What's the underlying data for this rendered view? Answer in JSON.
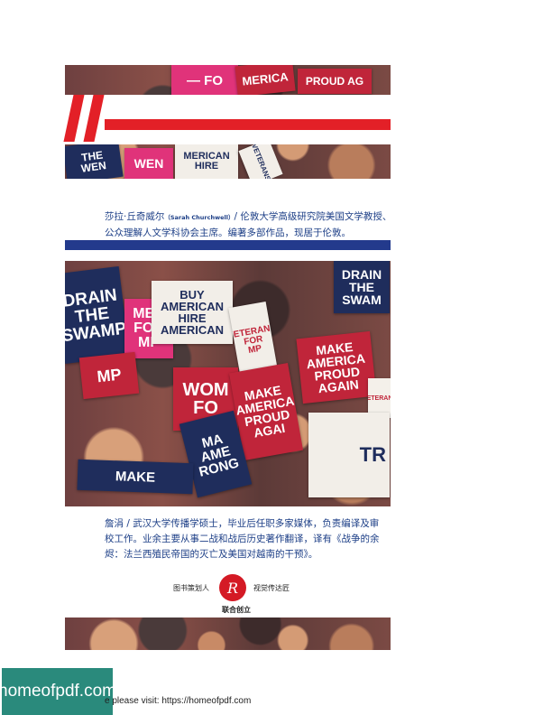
{
  "top_photo_signs": [
    {
      "text": "— FO",
      "style": "pink"
    },
    {
      "text": "MERICA",
      "style": "red"
    },
    {
      "text": "PROUD AG",
      "style": "red"
    },
    {
      "text": "THE\nWEN",
      "style": "navy"
    },
    {
      "text": "WEN",
      "style": "pink"
    },
    {
      "text": "MERICAN\nHIRE",
      "style": "white"
    },
    {
      "text": "VETERANS",
      "style": "white"
    }
  ],
  "bio_author": {
    "name": "莎拉·丘奇威尔",
    "name_en": "（Sarah Churchwell）",
    "desc_line1": "/  伦敦大学高级研究院美国文学教授、",
    "desc_line2": "公众理解人文学科协会主席。编著多部作品，现居于伦敦。"
  },
  "main_photo_signs": [
    {
      "text": "DRAIN\nTHE\nSWAMP",
      "style": "navy"
    },
    {
      "text": "MEN\nFOR\nMP",
      "style": "pink"
    },
    {
      "text": "BUY\nAMERICAN\nHIRE\nAMERICAN",
      "style": "white"
    },
    {
      "text": "VETERANS\nFOR\nMP",
      "style": "white"
    },
    {
      "text": "DRAIN\nTHE\nSWAM",
      "style": "navy"
    },
    {
      "text": "MP",
      "style": "red"
    },
    {
      "text": "WOM\nFO",
      "style": "red"
    },
    {
      "text": "MAKE\nAMERICA\nPROUD AGAI",
      "style": "red"
    },
    {
      "text": "MAKE\nAMERICA\nPROUD AGAIN",
      "style": "red"
    },
    {
      "text": "VETERANS",
      "style": "whitered"
    },
    {
      "text": "MA\nAME\nRONG",
      "style": "navy"
    },
    {
      "text": "MAKE",
      "style": "navy"
    },
    {
      "text": "TR",
      "style": "white"
    }
  ],
  "bio_translator": {
    "line1": "詹涓  /  武汉大学传播学硕士，毕业后任职多家媒体，负责编译及审",
    "line2": "校工作。业余主要从事二战和战后历史著作翻译，译有《战争的余",
    "line3": "烬：法兰西殖民帝国的灭亡及美国对越南的干预》。"
  },
  "publisher": {
    "left": "图书策划人",
    "logo_letter": "R",
    "right": "视觉传达匠",
    "center": "联合创立"
  },
  "footer": {
    "watermark": "homeofpdf.com",
    "text": "e please visit: https://homeofpdf.com"
  },
  "colors": {
    "bio_text": "#1d3f87",
    "accent_red": "#e32027",
    "rule_blue": "#233a8c",
    "watermark_bg": "#2a8a7c"
  }
}
